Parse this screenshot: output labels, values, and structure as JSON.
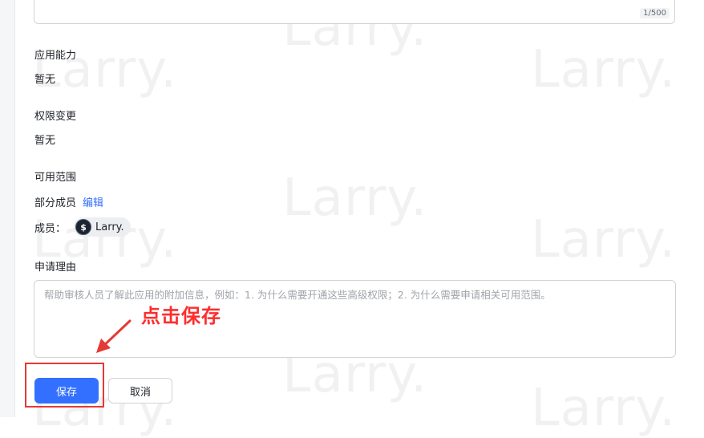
{
  "watermark": "Larry.",
  "description_field": {
    "counter": "1/500"
  },
  "app_capability": {
    "label": "应用能力",
    "value": "暂无"
  },
  "permission_change": {
    "label": "权限变更",
    "value": "暂无"
  },
  "availability": {
    "label": "可用范围",
    "scope_text": "部分成员",
    "edit_link": "编辑",
    "members_label": "成员：",
    "members": [
      {
        "name": "Larry.",
        "avatar_icon": "dollar-coin-icon"
      }
    ]
  },
  "reason": {
    "label": "申请理由",
    "placeholder": "帮助审核人员了解此应用的附加信息，例如：1. 为什么需要开通这些高级权限；2. 为什么需要申请相关可用范围。"
  },
  "annotation": {
    "text": "点击保存",
    "color": "#ff2d2d"
  },
  "actions": {
    "save_label": "保存",
    "cancel_label": "取消",
    "primary_color": "#3370ff"
  }
}
